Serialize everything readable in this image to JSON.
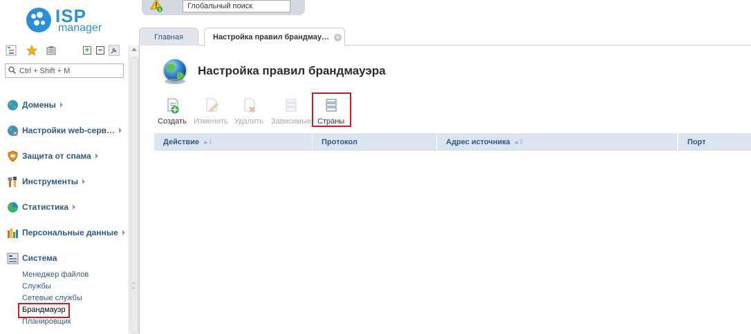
{
  "app": {
    "logo_word": "ISP",
    "logo_sub": "manager"
  },
  "topbar": {
    "global_search_placeholder": "Глобальный поиск",
    "warning_badge": "1"
  },
  "sidebar": {
    "search_placeholder": "Ctrl + Shift + M",
    "items": [
      {
        "label": "Домены"
      },
      {
        "label": "Настройки web-серв…"
      },
      {
        "label": "Защита от спама"
      },
      {
        "label": "Инструменты"
      },
      {
        "label": "Статистика"
      },
      {
        "label": "Персональные данные"
      },
      {
        "label": "Система"
      }
    ],
    "system_subitems": [
      {
        "label": "Менеджер файлов"
      },
      {
        "label": "Службы"
      },
      {
        "label": "Сетевые службы"
      },
      {
        "label": "Брандмауэр"
      },
      {
        "label": "Планировщик"
      }
    ]
  },
  "tabs": [
    {
      "label": "Главная"
    },
    {
      "label": "Настройка правил брандмау…"
    }
  ],
  "main": {
    "title": "Настройка правил брандмауэра",
    "toolbar": [
      {
        "label": "Создать",
        "enabled": true
      },
      {
        "label": "Изменить",
        "enabled": false
      },
      {
        "label": "Удалить",
        "enabled": false
      },
      {
        "label": "Зависимые",
        "enabled": false
      },
      {
        "label": "Страны",
        "enabled": true
      }
    ],
    "columns": [
      {
        "label": "Действие",
        "sort": "1"
      },
      {
        "label": "Протокол",
        "sort": ""
      },
      {
        "label": "Адрес источника",
        "sort": "2"
      },
      {
        "label": "Порт",
        "sort": ""
      }
    ]
  },
  "colors": {
    "accent": "#2a8fd6",
    "link": "#2d5a85",
    "highlight": "#e0141c",
    "grid_header": "#dbe5ef"
  }
}
